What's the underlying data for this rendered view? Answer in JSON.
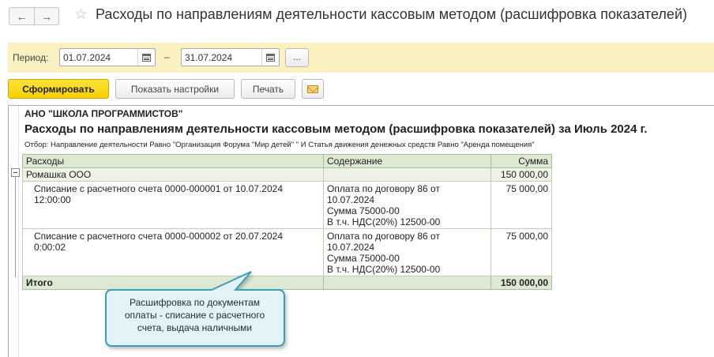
{
  "window": {
    "title": "Расходы по направлениям деятельности кассовым методом (расшифровка показателей)"
  },
  "nav": {
    "back_icon": "←",
    "forward_icon": "→",
    "favorite_icon": "☆"
  },
  "period": {
    "label": "Период:",
    "from": "01.07.2024",
    "dash": "–",
    "to": "31.07.2024",
    "more_label": "..."
  },
  "toolbar": {
    "generate_label": "Сформировать",
    "settings_label": "Показать настройки",
    "print_label": "Печать"
  },
  "report": {
    "organization": "АНО \"ШКОЛА ПРОГРАММИСТОВ\"",
    "title": "Расходы по направлениям деятельности кассовым методом (расшифровка показателей) за Июль 2024 г.",
    "filter": "Отбор: Направление деятельности Равно \"Организация Форума \"Мир детей\" \" И Статья движения денежных средств Равно \"Аренда помещения\"",
    "columns": [
      "Расходы",
      "Содержание",
      "Сумма"
    ],
    "group": {
      "name": "Ромашка ООО",
      "sum": "150 000,00"
    },
    "rows": [
      {
        "doc_line1": "Списание с расчетного счета 0000-000001 от 10.07.2024",
        "doc_line2": "12:00:00",
        "content_line1": "Оплата по договору 86 от",
        "content_line2": "10.07.2024",
        "content_line3": "Сумма 75000-00",
        "content_line4": "В т.ч. НДС(20%) 12500-00",
        "sum": "75 000,00"
      },
      {
        "doc_line1": "Списание с расчетного счета 0000-000002 от 20.07.2024",
        "doc_line2": "0:00:02",
        "content_line1": "Оплата по договору 86 от",
        "content_line2": "10.07.2024",
        "content_line3": "Сумма 75000-00",
        "content_line4": "В т.ч. НДС(20%) 12500-00",
        "sum": "75 000,00"
      }
    ],
    "total": {
      "label": "Итого",
      "sum": "150 000,00"
    }
  },
  "callout": {
    "line1": "Расшифровка по документам",
    "line2": "оплаты - списание с расчетного",
    "line3": "счета, выдача наличными"
  },
  "colors": {
    "accent_yellow": "#f7d000",
    "period_bg": "#fbf1c0",
    "table_header": "#dde9d3",
    "callout_fill": "#e3f3f8",
    "callout_border": "#3d9db8"
  }
}
